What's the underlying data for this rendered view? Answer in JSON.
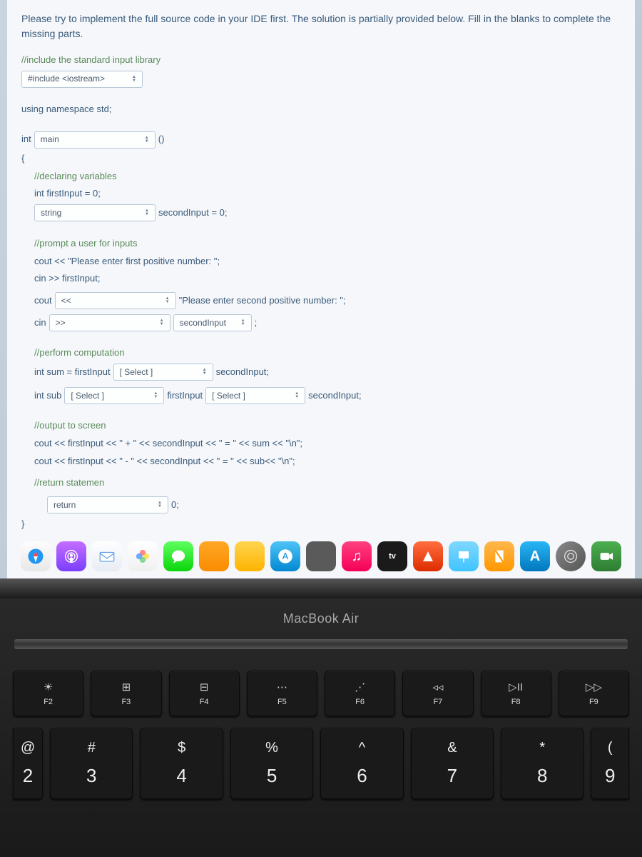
{
  "instructions": "Please try to implement the full source code in your IDE first. The solution is partially provided below. Fill in the blanks to complete the missing parts.",
  "code": {
    "c_include": "//include the standard input library",
    "include_val": "#include <iostream>",
    "using": "using namespace std;",
    "int_kw": "int",
    "main_val": "main",
    "paren": "()",
    "brace_open": "{",
    "c_declare": "//declaring variables",
    "first_decl": "int firstInput = 0;",
    "string_val": "string",
    "second_decl": "secondInput = 0;",
    "c_prompt": "//prompt a user for inputs",
    "cout1": "cout << \"Please enter first positive number: \";",
    "cin1": "cin >> firstInput;",
    "cout_kw": "cout",
    "ll_val": "<<",
    "prompt2": "\"Please enter second positive number: \";",
    "cin_kw": "cin",
    "gg_val": ">>",
    "second_input_val": "secondInput",
    "semicolon": ";",
    "c_compute": "//perform computation",
    "sum_prefix": "int sum = firstInput",
    "select_label": "[ Select ]",
    "second_input_semi": "secondInput;",
    "sub_prefix": "int sub",
    "first_input_txt": "firstInput",
    "second_input_txt2": "secondInput;",
    "c_output": "//output to screen",
    "out1": "cout << firstInput << \" + \" << secondInput << \" = \" << sum << \"\\n\";",
    "out2": "cout << firstInput << \" - \" << secondInput << \" = \" << sub<<  \"\\n\";",
    "c_return": "//return statemen",
    "return_val": "return",
    "zero_semi": "0;",
    "brace_close": "}"
  },
  "dock": {
    "tv_label": "tv"
  },
  "laptop": {
    "label": "MacBook Air"
  },
  "fn_keys": [
    {
      "icon": "☀",
      "label": "F2"
    },
    {
      "icon": "⊞",
      "label": "F3"
    },
    {
      "icon": "⊟",
      "label": "F4"
    },
    {
      "icon": "⋯",
      "label": "F5"
    },
    {
      "icon": "⋰",
      "label": "F6"
    },
    {
      "icon": "◃◃",
      "label": "F7"
    },
    {
      "icon": "▷II",
      "label": "F8"
    },
    {
      "icon": "▷▷",
      "label": "F9"
    }
  ],
  "num_keys": [
    {
      "sym": "@",
      "num": "2"
    },
    {
      "sym": "#",
      "num": "3"
    },
    {
      "sym": "$",
      "num": "4"
    },
    {
      "sym": "%",
      "num": "5"
    },
    {
      "sym": "^",
      "num": "6"
    },
    {
      "sym": "&",
      "num": "7"
    },
    {
      "sym": "*",
      "num": "8"
    },
    {
      "sym": "(",
      "num": "9"
    }
  ]
}
